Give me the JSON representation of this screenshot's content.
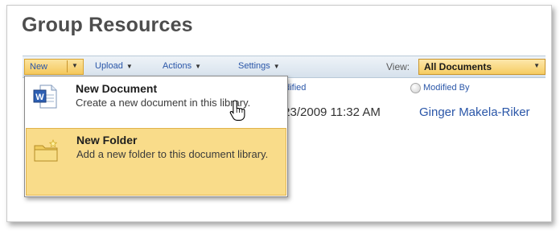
{
  "page": {
    "title": "Group Resources"
  },
  "toolbar": {
    "new_label": "New",
    "upload_label": "Upload",
    "actions_label": "Actions",
    "settings_label": "Settings",
    "view_label": "View:",
    "view_value": "All Documents"
  },
  "columns": {
    "modified": "odified",
    "modified_by": "Modified By"
  },
  "row": {
    "modified": "/23/2009 11:32 AM",
    "modified_by": "Ginger Makela-Riker"
  },
  "new_menu": {
    "items": [
      {
        "title": "New Document",
        "description": "Create a new document in this library.",
        "icon": "word-document-icon",
        "highlighted": false
      },
      {
        "title": "New Folder",
        "description": "Add a new folder to this document library.",
        "icon": "new-folder-icon",
        "highlighted": true
      }
    ]
  },
  "colors": {
    "link": "#2a56a8",
    "title": "#4d4d4d",
    "highlight": "#f9dc8a",
    "toolbar": "#dce6f0"
  }
}
